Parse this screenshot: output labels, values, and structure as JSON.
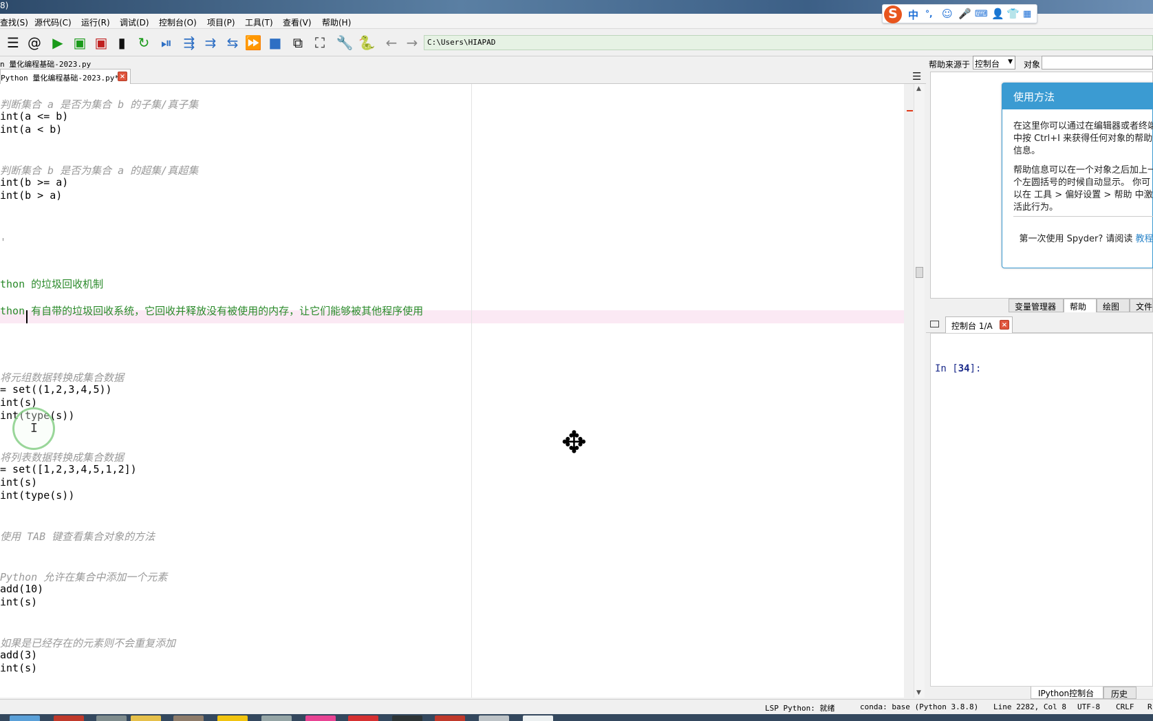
{
  "window": {
    "title_fragment": "8)"
  },
  "menu": {
    "items": [
      "查找(S)",
      "源代码(C)",
      "运行(R)",
      "调试(D)",
      "控制台(O)",
      "项目(P)",
      "工具(T)",
      "查看(V)",
      "帮助(H)"
    ]
  },
  "ime": {
    "logo": "S",
    "mode": "中",
    "punct": "°,"
  },
  "toolbar": {
    "path": "C:\\Users\\HIAPAD",
    "icons": [
      "list-icon",
      "at-icon",
      "run-icon",
      "run-cell-icon",
      "run-cell-advance-icon",
      "run-selection-icon",
      "rerun-icon",
      "debug-icon",
      "step-icon",
      "step-into-icon",
      "step-return-icon",
      "continue-icon",
      "stop-icon",
      "maximize-pane-icon",
      "fullscreen-icon",
      "wrench-icon",
      "python-icon",
      "back-arrow-icon",
      "forward-arrow-icon"
    ]
  },
  "editor": {
    "file_path": "n 量化编程基础-2023.py",
    "tab_label": "Python 量化编程基础-2023.py*",
    "lines": [
      {
        "text": "判断集合 a 是否为集合 b 的子集/真子集",
        "style": "c"
      },
      {
        "text": "int(a <= b)",
        "style": ""
      },
      {
        "text": "int(a < b)",
        "style": ""
      },
      {
        "text": "判断集合 b 是否为集合 a 的超集/真超集",
        "style": "c"
      },
      {
        "text": "int(b >= a)",
        "style": ""
      },
      {
        "text": "int(b > a)",
        "style": ""
      },
      {
        "text": "'",
        "style": "c"
      },
      {
        "text": "thon 的垃圾回收机制",
        "style": "g"
      },
      {
        "text": "thon 有自带的垃圾回收系统，它回收并释放没有被使用的内存，让它们能够被其他程序使用",
        "style": "g"
      },
      {
        "text": "将元组数据转换成集合数据",
        "style": "c"
      },
      {
        "text": "= set((1,2,3,4,5))",
        "style": ""
      },
      {
        "text": "int(s)",
        "style": ""
      },
      {
        "text": "int(type(s))",
        "style": ""
      },
      {
        "text": "将列表数据转换成集合数据",
        "style": "c"
      },
      {
        "text": "= set([1,2,3,4,5,1,2])",
        "style": ""
      },
      {
        "text": "int(s)",
        "style": ""
      },
      {
        "text": "int(type(s))",
        "style": ""
      },
      {
        "text": "使用 TAB 键查看集合对象的方法",
        "style": "c"
      },
      {
        "text": "Python 允许在集合中添加一个元素",
        "style": "c"
      },
      {
        "text": "add(10)",
        "style": ""
      },
      {
        "text": "int(s)",
        "style": ""
      },
      {
        "text": "如果是已经存在的元素则不会重复添加",
        "style": "c"
      },
      {
        "text": "add(3)",
        "style": ""
      },
      {
        "text": "int(s)",
        "style": ""
      }
    ]
  },
  "help": {
    "source_label": "帮助来源于",
    "source_value": "控制台",
    "object_label": "对象",
    "usage_title": "使用方法",
    "usage_p1": "在这里你可以通过在编辑器或者终端中按 Ctrl+I 来获得任何对象的帮助信息。",
    "usage_p2": "帮助信息可以在一个对象之后加上一个左圆括号的时候自动显示。 你可以在 工具 > 偏好设置 > 帮助 中激活此行为。",
    "usage_foot_prefix": "第一次使用 Spyder? 请阅读",
    "usage_foot_link": "教程"
  },
  "right_tabs": [
    "变量管理器",
    "帮助",
    "绘图",
    "文件"
  ],
  "console": {
    "tab_label": "控制台 1/A",
    "prompt_prefix": "In [",
    "prompt_num": "34",
    "prompt_suffix": "]:"
  },
  "bottom_tabs": [
    "IPython控制台",
    "历史"
  ],
  "status": {
    "lsp": "LSP Python: 就绪",
    "conda": "conda: base (Python 3.8.8)",
    "position": "Line 2282, Col 8",
    "encoding": "UTF-8",
    "eol": "CRLF",
    "rw": "R"
  }
}
